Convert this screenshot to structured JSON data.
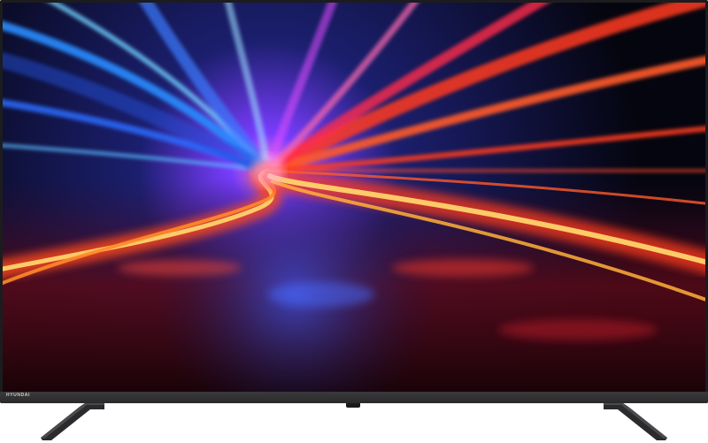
{
  "product": {
    "brand_logo_text": "HYUNDAI"
  },
  "colors": {
    "frame": "#1c1c1e",
    "bezel": "#2f2f31",
    "warm_streak": "#ff3b1f",
    "hot_streak": "#ffd36b",
    "cool_streak": "#2a8cff",
    "violet_glow": "#7a3cff"
  },
  "icons": {
    "stand_left": "tv-stand-foot-icon",
    "stand_right": "tv-stand-foot-icon",
    "sensor": "ir-sensor-icon"
  }
}
